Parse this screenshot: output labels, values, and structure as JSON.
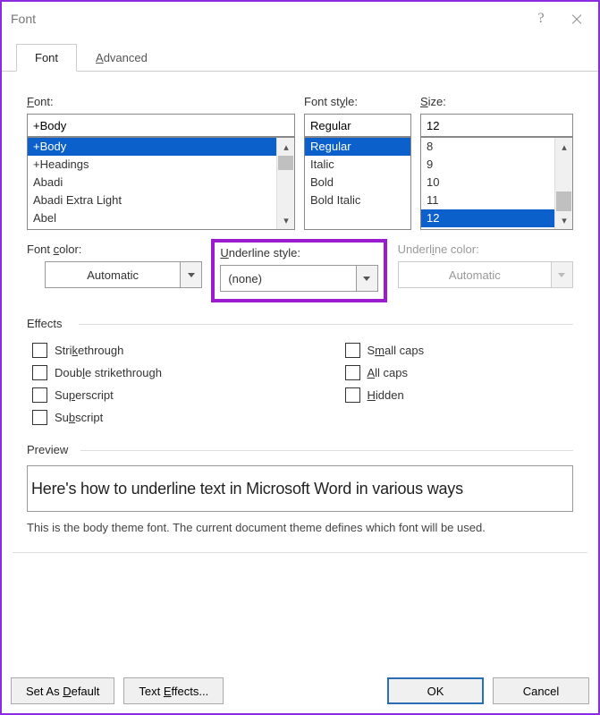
{
  "window": {
    "title": "Font"
  },
  "tabs": {
    "font": "Font",
    "advanced": "Advanced"
  },
  "labels": {
    "font": "Font:",
    "font_style": "Font style:",
    "size": "Size:",
    "font_color": "Font color:",
    "underline_style": "Underline style:",
    "underline_color": "Underline color:",
    "effects": "Effects",
    "preview": "Preview"
  },
  "font_input": "+Body",
  "font_list": [
    "+Body",
    "+Headings",
    "Abadi",
    "Abadi Extra Light",
    "Abel"
  ],
  "style_input": "Regular",
  "style_list": [
    "Regular",
    "Italic",
    "Bold",
    "Bold Italic"
  ],
  "size_input": "12",
  "size_list": [
    "8",
    "9",
    "10",
    "11",
    "12"
  ],
  "font_color_value": "Automatic",
  "underline_style_value": "(none)",
  "underline_color_value": "Automatic",
  "effects": {
    "strikethrough": "Strikethrough",
    "double_strikethrough": "Double strikethrough",
    "superscript": "Superscript",
    "subscript": "Subscript",
    "small_caps": "Small caps",
    "all_caps": "All caps",
    "hidden": "Hidden"
  },
  "preview_text": "Here's how to underline text in Microsoft Word in various ways",
  "preview_desc": "This is the body theme font. The current document theme defines which font will be used.",
  "buttons": {
    "set_default": "Set As Default",
    "text_effects": "Text Effects...",
    "ok": "OK",
    "cancel": "Cancel"
  }
}
